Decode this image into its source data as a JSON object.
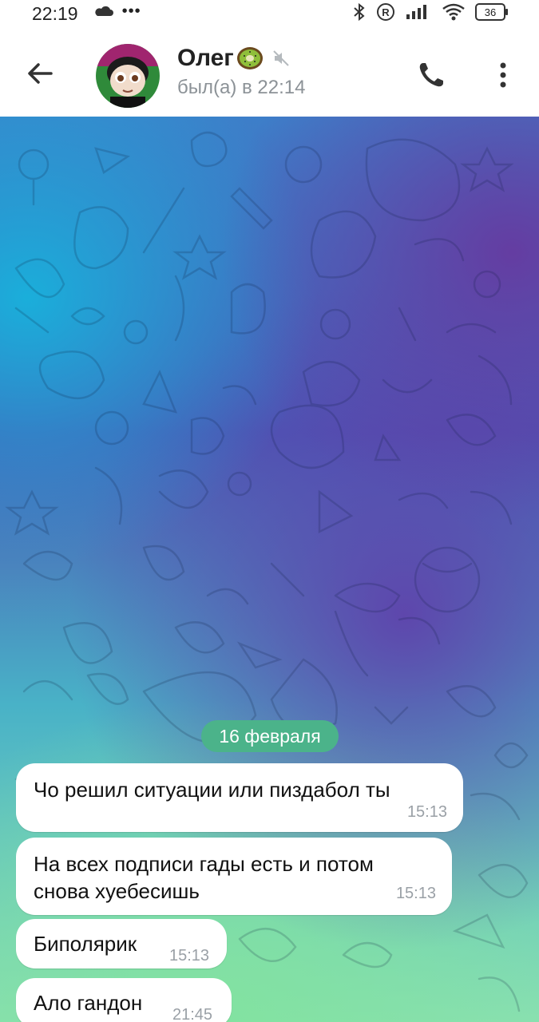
{
  "status_bar": {
    "time": "22:19",
    "dots": "•••",
    "battery": "36"
  },
  "header": {
    "contact_name": "Олег",
    "name_emoji": "kiwi-emoji",
    "last_seen": "был(а) в 22:14",
    "muted": true
  },
  "chat": {
    "date_divider": "16 февраля",
    "messages": [
      {
        "text": "Чо решил ситуации или пиздабол ты",
        "time": "15:13"
      },
      {
        "text_line1": "На всех подписи гады есть и потом",
        "text_line2": "снова хуебесишь",
        "time": "15:13"
      },
      {
        "text": "Биполярик",
        "time": "15:13"
      },
      {
        "text": "Ало гандон",
        "time": "21:45"
      }
    ]
  },
  "colors": {
    "accent_green": "#4bb38a",
    "gradient_purple": "#663aa0",
    "gradient_cyan": "#18b2dc",
    "gradient_mint": "#82e2a0"
  }
}
